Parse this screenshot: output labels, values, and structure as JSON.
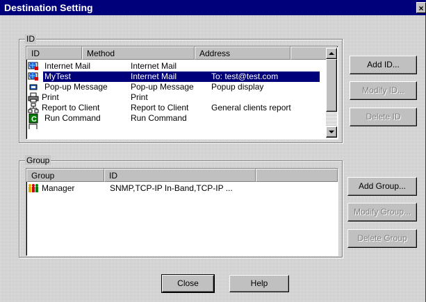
{
  "window": {
    "title": "Destination Setting",
    "close_glyph": "×"
  },
  "id_group": {
    "legend": "ID",
    "columns": [
      "ID",
      "Method",
      "Address"
    ],
    "rows": [
      {
        "icon": "internet-mail-icon",
        "id": "Internet Mail",
        "method": "Internet Mail",
        "address": "",
        "selected": false
      },
      {
        "icon": "internet-mail-icon",
        "id": "MyTest",
        "method": "Internet Mail",
        "address": "To: test@test.com",
        "selected": true
      },
      {
        "icon": "popup-message-icon",
        "id": "Pop-up Message",
        "method": "Pop-up Message",
        "address": "Popup display",
        "selected": false
      },
      {
        "icon": "printer-icon",
        "id": "Print",
        "method": "Print",
        "address": "",
        "selected": false
      },
      {
        "icon": "network-report-icon",
        "id": "Report to Client",
        "method": "Report to Client",
        "address": "General clients report",
        "selected": false
      },
      {
        "icon": "run-command-icon",
        "id": "Run Command",
        "method": "Run Command",
        "address": "",
        "selected": false
      }
    ],
    "buttons": {
      "add": {
        "label": "Add ID...",
        "underline": "A"
      },
      "modify": {
        "label": "Modify ID...",
        "underline": "M"
      },
      "delete": {
        "label": "Delete ID",
        "underline": "D"
      }
    }
  },
  "group_group": {
    "legend": "Group",
    "columns": [
      "Group",
      "ID"
    ],
    "rows": [
      {
        "icon": "people-group-icon",
        "group": "Manager",
        "id": "SNMP,TCP-IP In-Band,TCP-IP ..."
      }
    ],
    "buttons": {
      "add": {
        "label": "Add Group..."
      },
      "modify": {
        "label": "Modify Group..."
      },
      "delete": {
        "label": "Delete Group"
      }
    }
  },
  "footer": {
    "close": "Close",
    "help": "Help"
  },
  "colors": {
    "title_bar": "#00007b",
    "face": "#c0c0c0",
    "selection": "#00007b"
  }
}
